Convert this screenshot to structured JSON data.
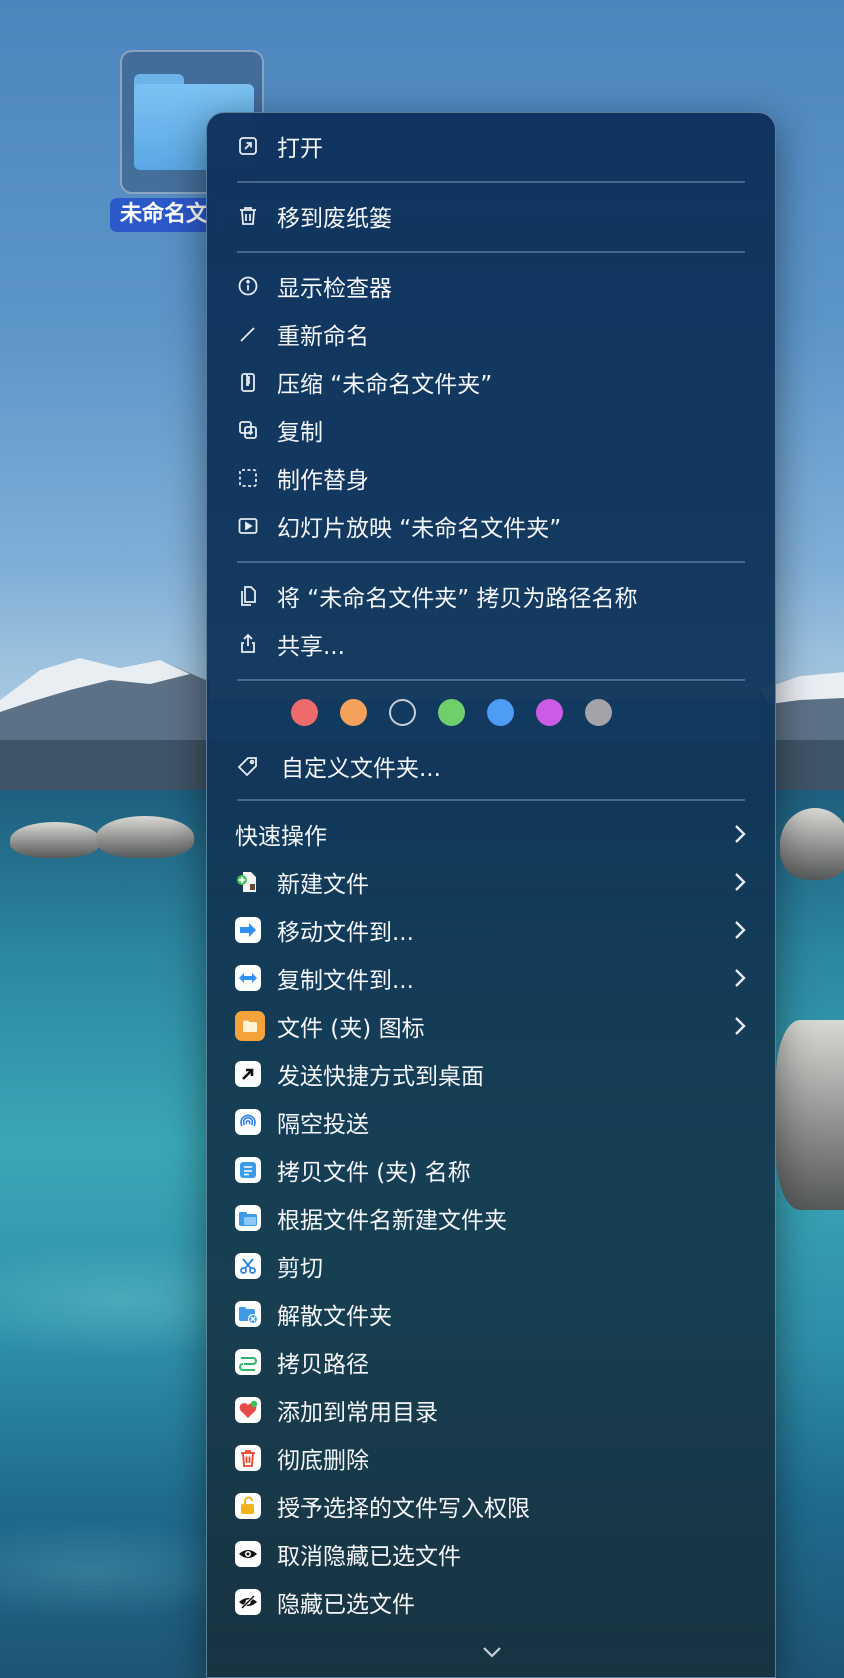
{
  "desktop": {
    "folder_label": "未命名文"
  },
  "menu": {
    "open": "打开",
    "trash": "移到废纸篓",
    "inspector": "显示检查器",
    "rename": "重新命名",
    "compress": "压缩 “未命名文件夹”",
    "duplicate": "复制",
    "alias": "制作替身",
    "slideshow": "幻灯片放映 “未命名文件夹”",
    "copy_path_name": "将 “未命名文件夹” 拷贝为路径名称",
    "share": "共享...",
    "tags": [
      {
        "name": "red",
        "color": "#ee6b6b"
      },
      {
        "name": "orange",
        "color": "#f4a15c"
      },
      {
        "name": "none",
        "color": "transparent"
      },
      {
        "name": "green",
        "color": "#6fcf6a"
      },
      {
        "name": "blue",
        "color": "#4f9cf7"
      },
      {
        "name": "purple",
        "color": "#cc5be6"
      },
      {
        "name": "gray",
        "color": "#a2a4a8"
      }
    ],
    "customize_folder": "自定义文件夹...",
    "quick_actions": "快速操作",
    "new_file": "新建文件",
    "move_file_to": "移动文件到...",
    "copy_file_to": "复制文件到...",
    "file_folder_icon": "文件 (夹) 图标",
    "send_shortcut": "发送快捷方式到桌面",
    "airdrop": "隔空投送",
    "copy_file_name": "拷贝文件 (夹) 名称",
    "new_folder_from_name": "根据文件名新建文件夹",
    "cut": "剪切",
    "dissolve_folder": "解散文件夹",
    "copy_path": "拷贝路径",
    "add_favorites": "添加到常用目录",
    "delete_permanently": "彻底删除",
    "grant_write": "授予选择的文件写入权限",
    "unhide_selected": "取消隐藏已选文件",
    "hide_selected": "隐藏已选文件"
  }
}
